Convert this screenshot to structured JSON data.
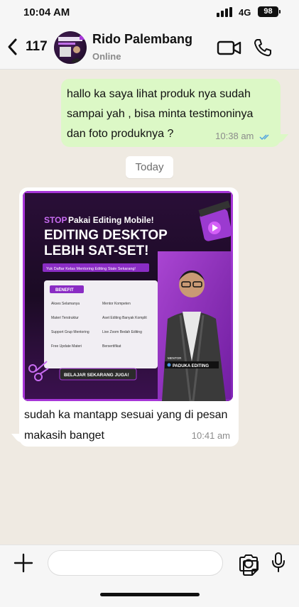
{
  "status_bar": {
    "time": "10:04 AM",
    "network": "4G",
    "battery": "98"
  },
  "header": {
    "unread_count": "117",
    "contact_name": "Rido Palembang",
    "contact_status": "Online"
  },
  "messages": {
    "outgoing": {
      "text": "hallo ka saya lihat produk nya sudah sampai yah , bisa minta testimoninya dan foto produknya ?",
      "time": "10:38 am"
    },
    "date_separator": "Today",
    "incoming": {
      "text": "sudah ka mantapp sesuai yang di pesan makasih banget",
      "time": "10:41 am"
    }
  },
  "media_poster": {
    "stop_word": "STOP",
    "headline_small": "Pakai Editing Mobile!",
    "headline_1": "EDITING DESKTOP",
    "headline_2": "LEBIH SAT-SET!",
    "subline": "Yuk Daftar Kelas Mentoring Editing Stale Sekarang!",
    "benefit_label": "BENEFIT",
    "benefits_left": [
      "Akses Selamanya",
      "Materi Terstruktur",
      "Support Grup Mentoring",
      "Free Update Materi"
    ],
    "benefits_right": [
      "Mentor Kompeten",
      "Aset Editing Banyak Komplit",
      "Live Zoom Bedah Editing",
      "Bersertifikat"
    ],
    "cta": "BELAJAR SEKARANG JUGA!",
    "mentor_label": "MENTOR",
    "mentor_name": "PADUKA EDITING",
    "accent_color": "#a736d8"
  },
  "icons": [
    "back-chevron",
    "video-call",
    "voice-call",
    "plus",
    "sticker",
    "camera",
    "microphone"
  ]
}
